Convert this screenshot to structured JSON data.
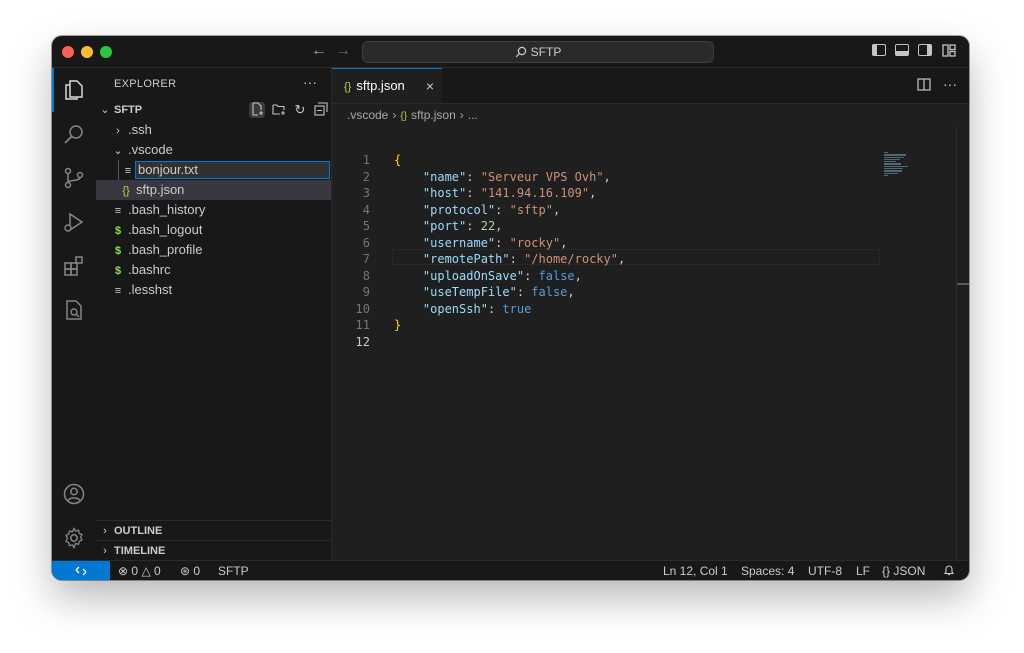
{
  "titlebar": {
    "search_label": "SFTP"
  },
  "explorer": {
    "header": "EXPLORER",
    "folder_name": "SFTP",
    "tree": [
      {
        "label": ".ssh",
        "kind": "folder-collapsed"
      },
      {
        "label": ".vscode",
        "kind": "folder-expanded"
      },
      {
        "label": "bonjour.txt",
        "kind": "file-renaming"
      },
      {
        "label": "sftp.json",
        "kind": "json"
      },
      {
        "label": ".bash_history",
        "kind": "text"
      },
      {
        "label": ".bash_logout",
        "kind": "shell"
      },
      {
        "label": ".bash_profile",
        "kind": "shell"
      },
      {
        "label": ".bashrc",
        "kind": "shell"
      },
      {
        "label": ".lesshst",
        "kind": "text"
      }
    ],
    "outline_label": "OUTLINE",
    "timeline_label": "TIMELINE"
  },
  "editor": {
    "tab_label": "sftp.json",
    "breadcrumb": [
      ".vscode",
      "sftp.json",
      "..."
    ],
    "code": [
      "{",
      "    \"name\": \"Serveur VPS Ovh\",",
      "    \"host\": \"141.94.16.109\",",
      "    \"protocol\": \"sftp\",",
      "    \"port\": 22,",
      "    \"username\": \"rocky\",",
      "    \"remotePath\": \"/home/rocky\",",
      "    \"uploadOnSave\": false,",
      "    \"useTempFile\": false,",
      "    \"openSsh\": true",
      "}",
      ""
    ],
    "line_numbers": [
      "1",
      "2",
      "3",
      "4",
      "5",
      "6",
      "7",
      "8",
      "9",
      "10",
      "11",
      "12"
    ]
  },
  "statusbar": {
    "errors": "0",
    "warnings": "0",
    "ports": "0",
    "remote_name": "SFTP",
    "position": "Ln 12, Col 1",
    "spaces": "Spaces: 4",
    "encoding": "UTF-8",
    "eol": "LF",
    "language": "JSON"
  },
  "colors": {
    "accent": "#0078d4",
    "json_icon": "#cbcb41",
    "shell_icon": "#89e051"
  }
}
